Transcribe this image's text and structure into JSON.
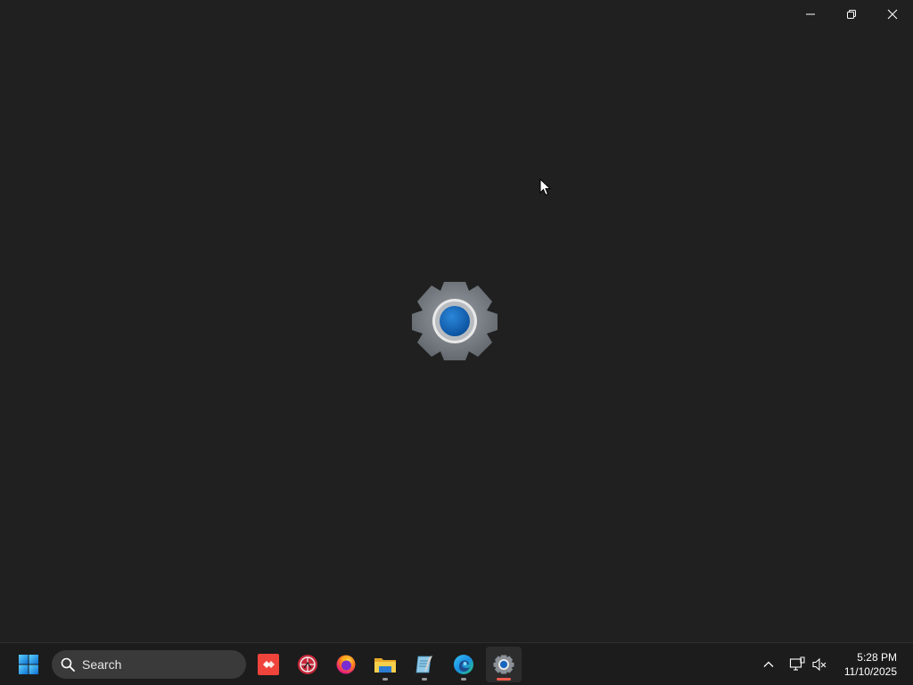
{
  "window": {
    "controls": {
      "minimize_icon": "minimize-icon",
      "restore_icon": "restore-icon",
      "close_icon": "close-icon"
    },
    "splash_icon": "settings-gear-icon"
  },
  "taskbar": {
    "start_icon": "windows-start-icon",
    "search": {
      "placeholder": "Search"
    },
    "pinned": [
      {
        "name": "anydesk",
        "icon": "anydesk-icon",
        "running": false
      },
      {
        "name": "scissors-app",
        "icon": "red-round-app-icon",
        "running": false
      },
      {
        "name": "firefox",
        "icon": "firefox-icon",
        "running": false
      },
      {
        "name": "file-explorer",
        "icon": "folder-icon",
        "running": true
      },
      {
        "name": "notepad",
        "icon": "notepad-icon",
        "running": true
      },
      {
        "name": "edge",
        "icon": "edge-icon",
        "running": true
      },
      {
        "name": "settings",
        "icon": "settings-gear-icon",
        "running": true,
        "active": true
      }
    ],
    "tray": {
      "overflow_icon": "chevron-up-icon",
      "network_icon": "network-icon",
      "volume_icon": "volume-muted-icon"
    },
    "clock": {
      "time": "5:28 PM",
      "date": "11/10/2025"
    }
  },
  "colors": {
    "background": "#202020",
    "taskbar": "#1c1c1c",
    "accent": "#0f6cbd",
    "active_indicator": "#f25a4a"
  }
}
